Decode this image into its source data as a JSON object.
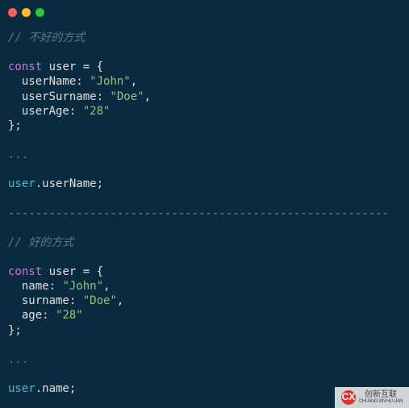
{
  "titlebar": {
    "close_color": "#ff5f56",
    "min_color": "#ffbd2e",
    "max_color": "#27c93f"
  },
  "section_bad": {
    "comment": "// 不好的方式",
    "decl_kw": "const",
    "var_name": "user",
    "eq_open": " = {",
    "props": [
      {
        "key": "userName",
        "value": "\"John\"",
        "trailing": ","
      },
      {
        "key": "userSurname",
        "value": "\"Doe\"",
        "trailing": ","
      },
      {
        "key": "userAge",
        "value": "\"28\"",
        "trailing": ""
      }
    ],
    "close": "};",
    "ellipsis": "...",
    "usage_obj": "user",
    "usage_prop": ".userName;",
    "separator": "--------------------------------------------------------"
  },
  "section_good": {
    "comment": "// 好的方式",
    "decl_kw": "const",
    "var_name": "user",
    "eq_open": " = {",
    "props": [
      {
        "key": "name",
        "value": "\"John\"",
        "trailing": ","
      },
      {
        "key": "surname",
        "value": "\"Doe\"",
        "trailing": ","
      },
      {
        "key": "age",
        "value": "\"28\"",
        "trailing": ""
      }
    ],
    "close": "};",
    "ellipsis": "...",
    "usage_obj": "user",
    "usage_prop": ".name;"
  },
  "watermark": {
    "logo_text": "CX",
    "line1": "创新互联",
    "line2": "CHUANG XIN HU LIAN"
  }
}
